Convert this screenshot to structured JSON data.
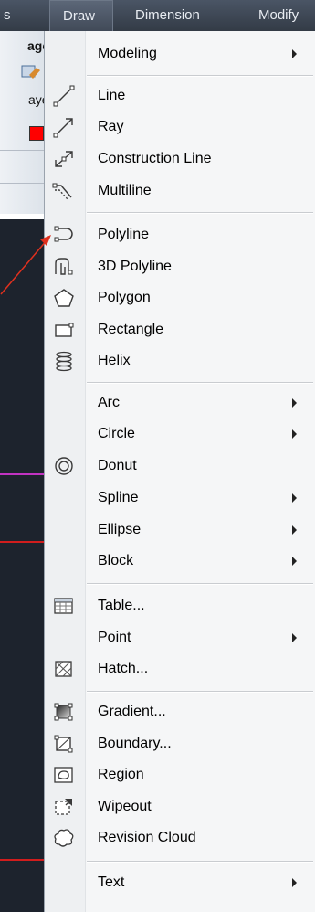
{
  "menubar": {
    "items": [
      "s",
      "Draw",
      "Dimension",
      "Modify"
    ]
  },
  "background": {
    "toolbar_fragments": [
      "age",
      "aye"
    ]
  },
  "draw_menu": {
    "items": [
      {
        "label": "Modeling",
        "submenu": true
      },
      {
        "label": "Line",
        "icon": "line-icon"
      },
      {
        "label": "Ray",
        "icon": "ray-icon"
      },
      {
        "label": "Construction Line",
        "icon": "construction-line-icon"
      },
      {
        "label": "Multiline",
        "icon": "multiline-icon"
      },
      {
        "label": "Polyline",
        "icon": "polyline-icon"
      },
      {
        "label": "3D Polyline",
        "icon": "3d-polyline-icon"
      },
      {
        "label": "Polygon",
        "icon": "polygon-icon"
      },
      {
        "label": "Rectangle",
        "icon": "rectangle-icon"
      },
      {
        "label": "Helix",
        "icon": "helix-icon"
      },
      {
        "label": "Arc",
        "submenu": true
      },
      {
        "label": "Circle",
        "submenu": true
      },
      {
        "label": "Donut",
        "icon": "donut-icon"
      },
      {
        "label": "Spline",
        "submenu": true
      },
      {
        "label": "Ellipse",
        "submenu": true
      },
      {
        "label": "Block",
        "submenu": true
      },
      {
        "label": "Table...",
        "icon": "table-icon"
      },
      {
        "label": "Point",
        "submenu": true
      },
      {
        "label": "Hatch...",
        "icon": "hatch-icon"
      },
      {
        "label": "Gradient...",
        "icon": "gradient-icon"
      },
      {
        "label": "Boundary...",
        "icon": "boundary-icon"
      },
      {
        "label": "Region",
        "icon": "region-icon"
      },
      {
        "label": "Wipeout",
        "icon": "wipeout-icon"
      },
      {
        "label": "Revision Cloud",
        "icon": "revision-cloud-icon"
      },
      {
        "label": "Text",
        "submenu": true
      }
    ]
  },
  "colors": {
    "menubar": "#3b4350",
    "menu_background": "#f5f6f7",
    "annotation_arrow": "#e0301e",
    "drawing_background": "#1d232d",
    "layer_color_swatch": "#ff0000"
  }
}
